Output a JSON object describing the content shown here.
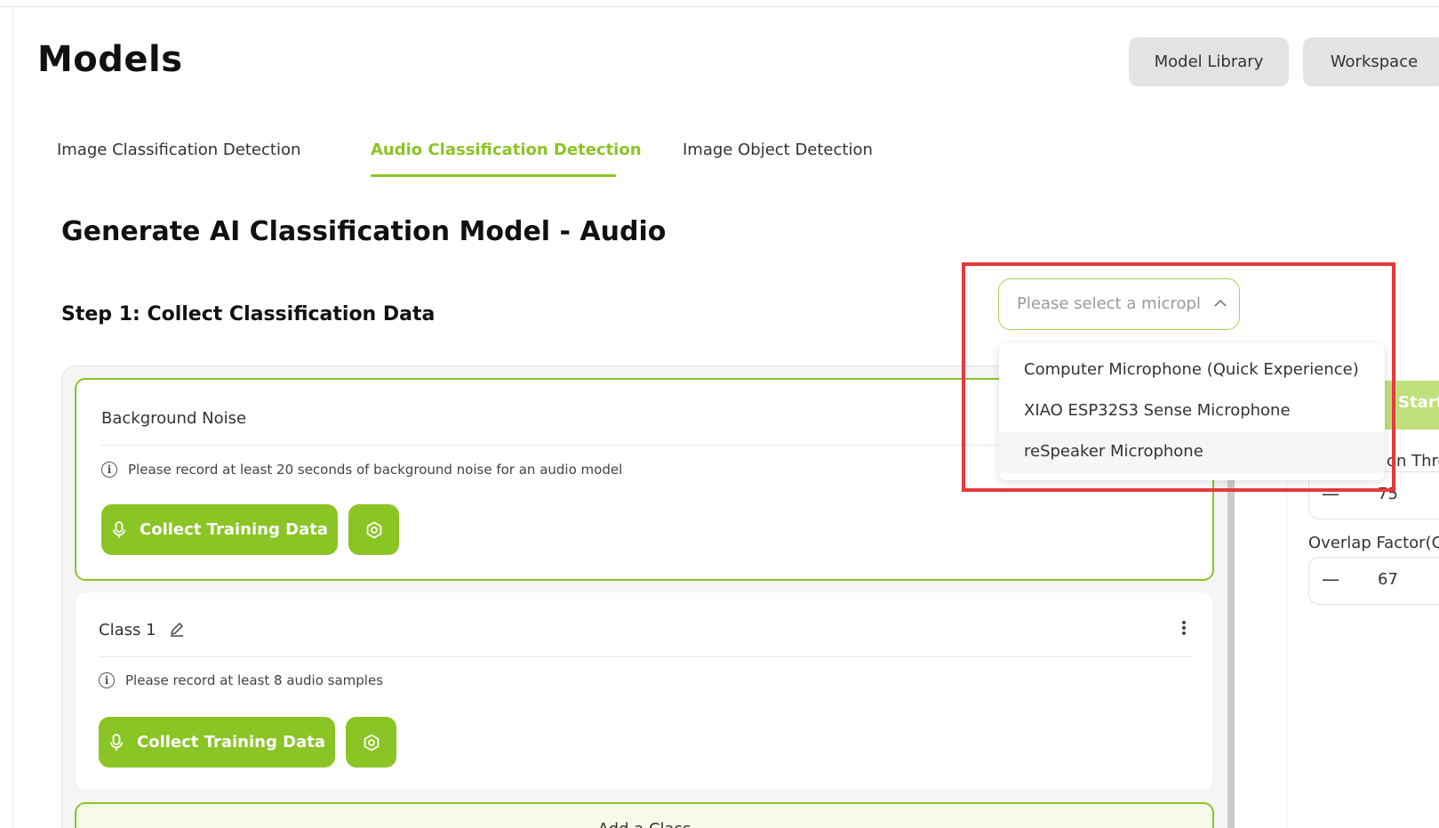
{
  "header": {
    "title": "Models",
    "model_library_label": "Model Library",
    "workspace_label": "Workspace"
  },
  "tabs": [
    {
      "label": "Image Classification Detection",
      "active": false
    },
    {
      "label": "Audio Classification Detection",
      "active": true
    },
    {
      "label": "Image Object Detection",
      "active": false
    }
  ],
  "section_title": "Generate AI Classification Model - Audio",
  "step1_title": "Step 1: Collect Classification Data",
  "cards": {
    "background": {
      "title": "Background Noise",
      "hint": "Please record at least 20 seconds of background noise for an audio model",
      "collect_label": "Collect Training Data"
    },
    "class1": {
      "title": "Class 1",
      "hint": "Please record at least 8 audio samples",
      "collect_label": "Collect Training Data"
    },
    "add_class_label": "Add a Class"
  },
  "right_panel": {
    "start_label": "Start",
    "threshold_label": "on Thre",
    "threshold_value": "75",
    "overlap_label": "Overlap Factor(C",
    "overlap_value": "67"
  },
  "mic_select": {
    "placeholder": "Please select a micropl",
    "options": [
      "Computer Microphone (Quick Experience)",
      "XIAO ESP32S3 Sense Microphone",
      "reSpeaker Microphone"
    ],
    "hovered_index": 2
  },
  "colors": {
    "accent": "#8bc425",
    "highlight": "#e8383b"
  }
}
